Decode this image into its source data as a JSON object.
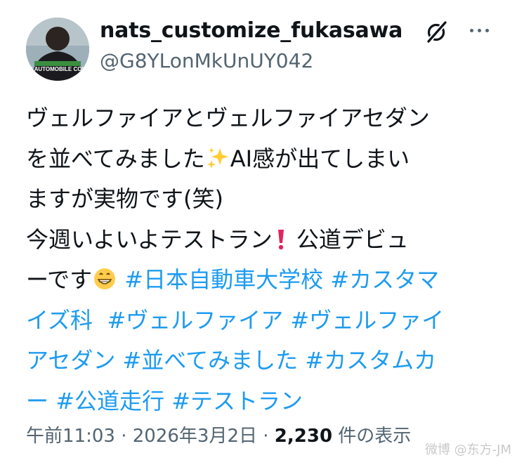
{
  "author": {
    "display_name": "nats_customize_fukasawa",
    "handle": "@G8YLonMkUnUY042",
    "avatar_text": "NIHON AUTOMOBILE COLLEGE"
  },
  "icons": {
    "grok": "grok-icon",
    "more": "more-icon",
    "sparkles": "sparkles-emoji",
    "exclamation": "exclamation-emoji",
    "grin": "grinning-face-emoji"
  },
  "tweet": {
    "line1": "ヴェルファイアとヴェルファイアセダン",
    "line2a": "を並べてみました",
    "line2b": "AI感が出てしまい",
    "line3": "ますが実物です(笑)",
    "line4a": "今週いよいよテストラン",
    "line4b": " 公道デビュ",
    "line5a": "ーです",
    "hashtags": {
      "h1": "#日本自動車大学校",
      "h2a": "#カスタマ",
      "h2b": "イズ科",
      "h3": "#ヴェルファイア",
      "h4a": "#ヴェルファイ",
      "h4b": "アセダン",
      "h5": "#並べてみました",
      "h6a": "#カスタムカ",
      "h6b": "ー",
      "h7": "#公道走行",
      "h8": "#テストラン"
    }
  },
  "meta": {
    "time": "午前11:03",
    "sep": " · ",
    "date": "2026年3月2日",
    "views_count": "2,230",
    "views_label": " 件の表示"
  },
  "colors": {
    "link": "#1d9bf0",
    "text": "#0f1419",
    "secondary": "#536471"
  },
  "watermark": "微博 @东方-JM"
}
